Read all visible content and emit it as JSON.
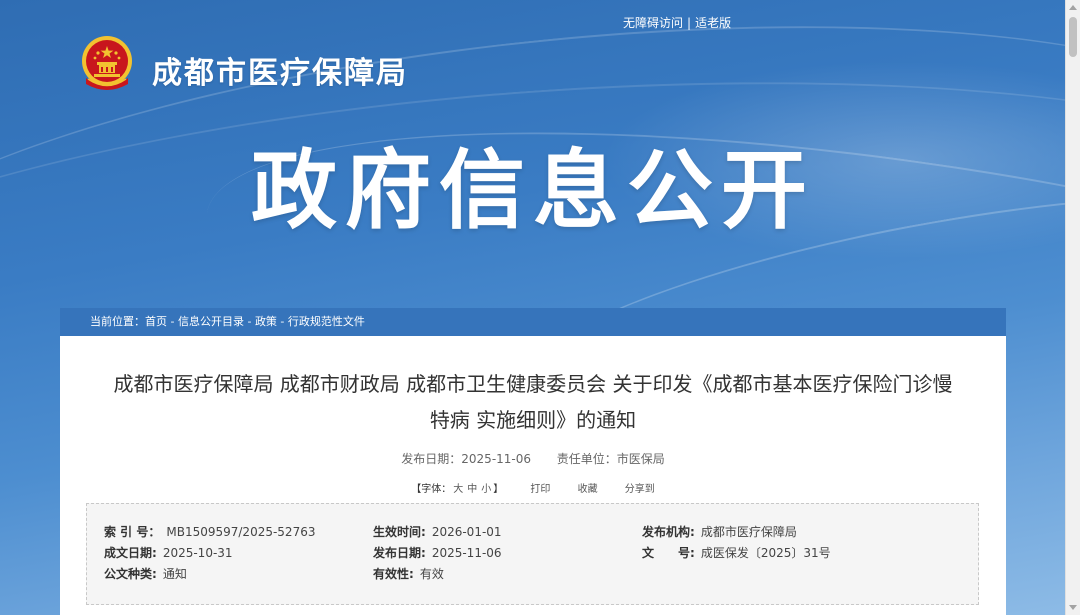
{
  "header": {
    "top_links": [
      "无障碍访问",
      "适老版"
    ],
    "top_links_separator": "|",
    "site_name": "成都市医疗保障局",
    "banner_title": "政府信息公开",
    "emblem_icon": "national-emblem-icon"
  },
  "breadcrumb": {
    "prefix": "当前位置：",
    "items": [
      "首页",
      "信息公开目录",
      "政策",
      "行政规范性文件"
    ],
    "separator": " - "
  },
  "article": {
    "title_line1": "成都市医疗保障局 成都市财政局 成都市卫生健康委员会 关于印发《成都市基本医疗保险门诊慢",
    "title_line2": "特病 实施细则》的通知",
    "publish_date_label": "发布日期：",
    "publish_date": "2025-11-06",
    "department_label": "责任单位：",
    "department": "市医保局"
  },
  "tools": {
    "font_size_prefix": "【字体：",
    "font_sizes": [
      "大",
      "中",
      "小"
    ],
    "font_size_suffix": "】",
    "print": "打印",
    "favorite": "收藏",
    "share": "分享到"
  },
  "info": {
    "index_no_label": "索 引 号：",
    "index_no": "MB1509597/2025-52763",
    "effective_time_label": "生效时间:",
    "effective_time": "2026-01-01",
    "issuer_label": "发布机构:",
    "issuer": "成都市医疗保障局",
    "written_date_label": "成文日期:",
    "written_date": "2025-10-31",
    "publish_date_label": "发布日期:",
    "publish_date": "2025-11-06",
    "doc_no_label": "文　　号:",
    "doc_no": "成医保发〔2025〕31号",
    "doc_type_label": "公文种类:",
    "doc_type": "通知",
    "validity_label": "有效性:",
    "validity": "有效"
  },
  "colors": {
    "banner": "#3a7cc4",
    "breadcrumb_bar": "#3674bb",
    "emblem_red": "#c8161d",
    "emblem_gold": "#f2c230"
  }
}
